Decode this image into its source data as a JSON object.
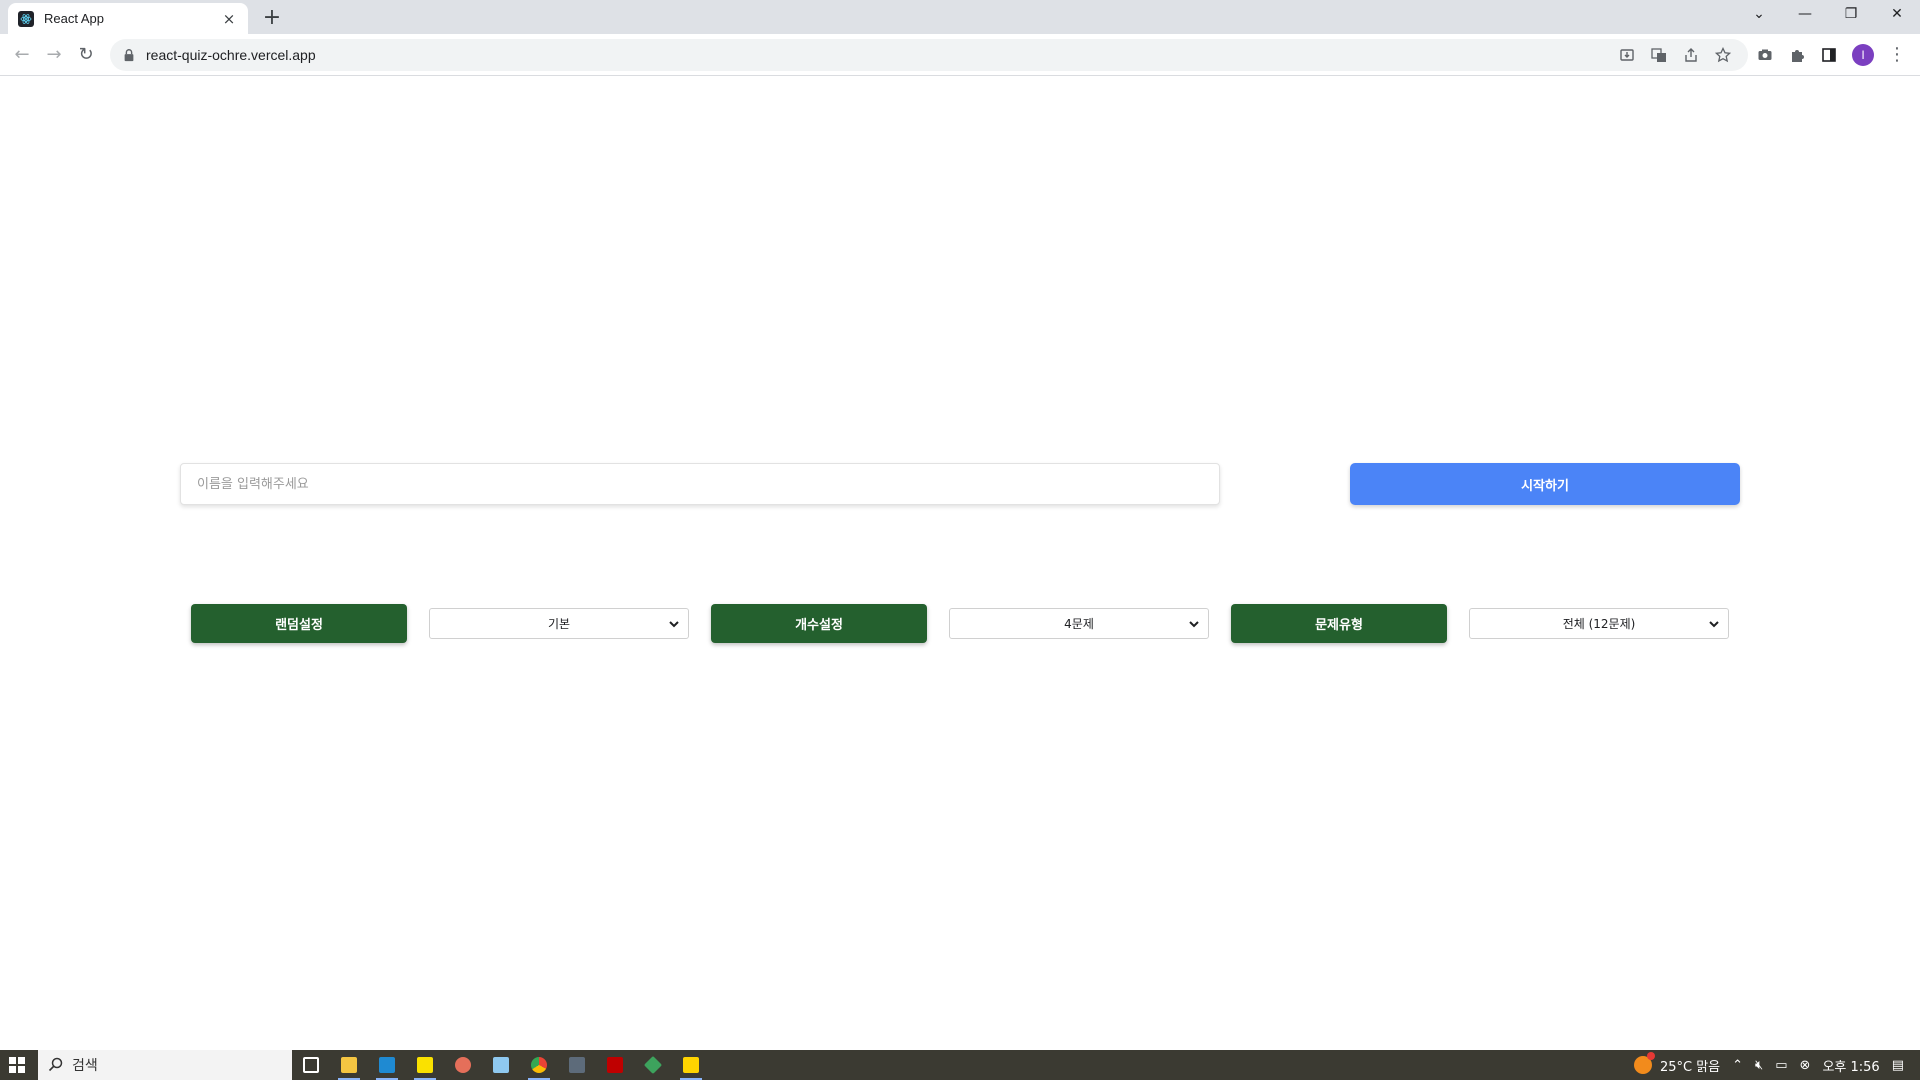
{
  "browser": {
    "tab_title": "React App",
    "tab_close": "×",
    "new_tab": "+",
    "url": "react-quiz-ochre.vercel.app",
    "avatar_letter": "I",
    "window_controls": {
      "list": "⌄",
      "minimize": "—",
      "restore": "❐",
      "close": "✕"
    }
  },
  "page": {
    "name_input": {
      "placeholder": "이름을 입력해주세요",
      "value": ""
    },
    "start_button": "시작하기",
    "settings": [
      {
        "button": "랜덤설정",
        "select_value": "기본"
      },
      {
        "button": "개수설정",
        "select_value": "4문제"
      },
      {
        "button": "문제유형",
        "select_value": "전체 (12문제)"
      }
    ],
    "colors": {
      "green": "#24602e",
      "blue": "#4b84f7"
    }
  },
  "taskbar": {
    "search_text": "검색",
    "weather": "25°C 맑음",
    "time": "오후 1:56"
  }
}
